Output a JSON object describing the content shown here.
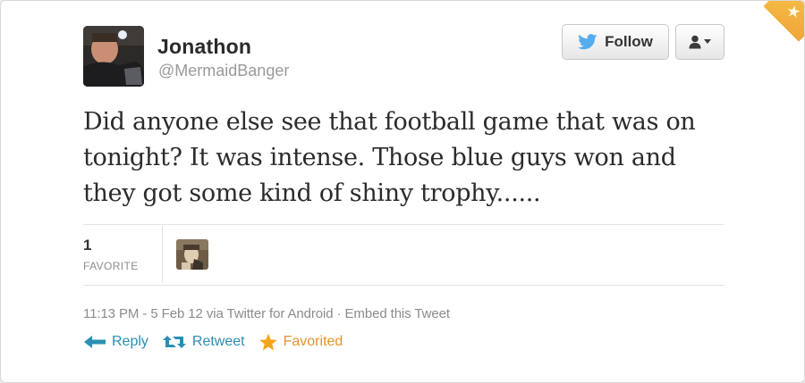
{
  "author": {
    "name": "Jonathon",
    "handle": "@MermaidBanger"
  },
  "buttons": {
    "follow_label": "Follow"
  },
  "tweet": {
    "text": "Did anyone else see that football game that was on tonight? It was intense. Those blue guys won and they got some kind of shiny trophy......"
  },
  "stats": {
    "favorite_count": "1",
    "favorite_label": "FAVORITE"
  },
  "meta": {
    "time": "11:13 PM",
    "date_sep": " - ",
    "date": "5 Feb 12",
    "via": " via ",
    "client": "Twitter for Android",
    "dot": " · ",
    "embed": "Embed this Tweet"
  },
  "actions": {
    "reply": "Reply",
    "retweet": "Retweet",
    "favorited": "Favorited"
  },
  "colors": {
    "link_blue": "#2a8fb3",
    "favorited_orange": "#e3932a",
    "twitter_bird": "#55acee"
  },
  "icons": {
    "corner": "favorited-star-icon",
    "follow": "twitter-bird-icon",
    "user_menu": "user-icon",
    "reply": "reply-arrow-icon",
    "retweet": "retweet-icon",
    "favorite": "star-icon"
  }
}
